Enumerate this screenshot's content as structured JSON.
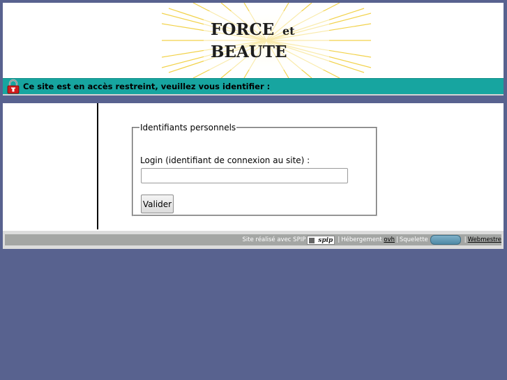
{
  "header": {
    "logo_line1": "FORCE",
    "logo_et": "et",
    "logo_line2": "BEAUTE"
  },
  "banner": {
    "message": "Ce site est en accès restreint, veuillez vous identifier :",
    "icon": "lock-icon",
    "color": "#17a5a0"
  },
  "login": {
    "legend": "Identifiants personnels",
    "label": "Login (identifiant de connexion au site) :",
    "value": "",
    "submit_label": "Valider"
  },
  "footer": {
    "made_with": "Site réalisé avec SPIP",
    "spip_logo_text": "spip",
    "hosting_label": "Hébergement",
    "hosting_link": "ovh",
    "skeleton_label": "Squelette",
    "webmaster_link": "Webmestre",
    "separator": "|"
  },
  "colors": {
    "background": "#58628f",
    "banner": "#17a5a0",
    "footer_bar": "#a4a6a4"
  }
}
